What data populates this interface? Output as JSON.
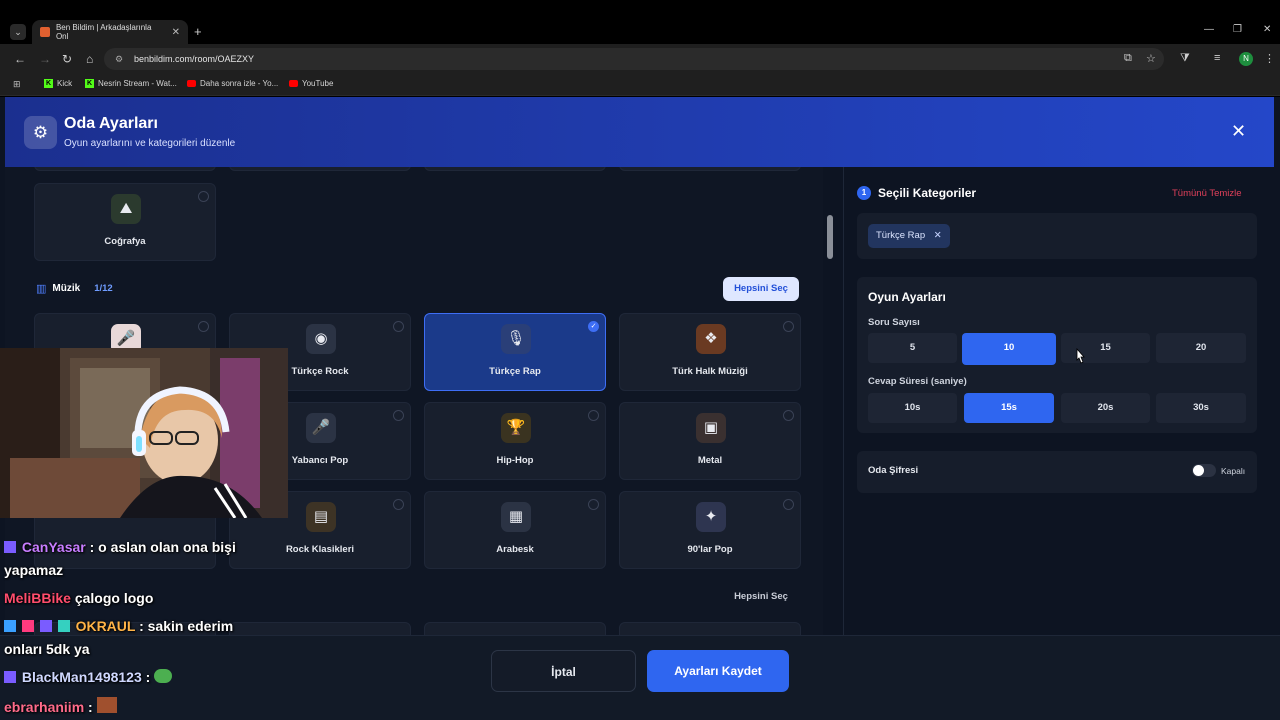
{
  "browser": {
    "tab_title": "Ben Bildim | Arkadaşlarınla Onl",
    "url": "benbildim.com/room/OAEZXY",
    "profile_initial": "N",
    "bookmarks": [
      "Kick",
      "Nesrin Stream - Wat...",
      "Daha sonra izle - Yo...",
      "YouTube"
    ]
  },
  "modal": {
    "title": "Oda Ayarları",
    "subtitle": "Oyun ayarlarını ve kategorileri düzenle"
  },
  "categories": {
    "geography_label": "Coğrafya",
    "music_section": {
      "title": "Müzik",
      "count": "1/12",
      "select_all": "Hepsini Seç"
    },
    "music_items": [
      {
        "label": "",
        "selected": false
      },
      {
        "label": "Türkçe Rock",
        "selected": false
      },
      {
        "label": "Türkçe Rap",
        "selected": true
      },
      {
        "label": "Türk Halk Müziği",
        "selected": false
      },
      {
        "label": "",
        "selected": false
      },
      {
        "label": "Yabancı Pop",
        "selected": false
      },
      {
        "label": "Hip-Hop",
        "selected": false
      },
      {
        "label": "Metal",
        "selected": false
      },
      {
        "label": "",
        "selected": false
      },
      {
        "label": "Rock Klasikleri",
        "selected": false
      },
      {
        "label": "Arabesk",
        "selected": false
      },
      {
        "label": "90'lar Pop",
        "selected": false
      }
    ],
    "next_select_all": "Hepsini Seç"
  },
  "selected_panel": {
    "step": "1",
    "title": "Seçili Kategoriler",
    "clear_all": "Tümünü Temizle",
    "chips": [
      "Türkçe Rap"
    ]
  },
  "game_settings": {
    "title": "Oyun Ayarları",
    "question_count_label": "Soru Sayısı",
    "question_counts": [
      "5",
      "10",
      "15",
      "20"
    ],
    "question_count_selected": "10",
    "answer_time_label": "Cevap Süresi (saniye)",
    "answer_times": [
      "10s",
      "15s",
      "20s",
      "30s"
    ],
    "answer_time_selected": "15s"
  },
  "password": {
    "label": "Oda Şifresi",
    "state": "Kapalı"
  },
  "footer": {
    "cancel": "İptal",
    "save": "Ayarları Kaydet"
  },
  "chat": [
    {
      "user": "CanYasar",
      "user_color": "#c77dff",
      "text": ": o aslan olan ona bişi"
    },
    {
      "user": "",
      "user_color": "#ffffff",
      "text": "yapamaz"
    },
    {
      "user": "MeliBBike",
      "user_color": "#ff4d6d",
      "text": "çalogo logo"
    },
    {
      "user": "OKRAUL",
      "user_color": "#ffb347",
      "text": ": sakin ederim"
    },
    {
      "user": "",
      "user_color": "#ffffff",
      "text": "onları 5dk ya"
    },
    {
      "user": "BlackMan1498123",
      "user_color": "#cfd8ff",
      "text": ":"
    },
    {
      "user": "ebrarhaniim",
      "user_color": "#ff6b8b",
      "text": ":"
    }
  ]
}
